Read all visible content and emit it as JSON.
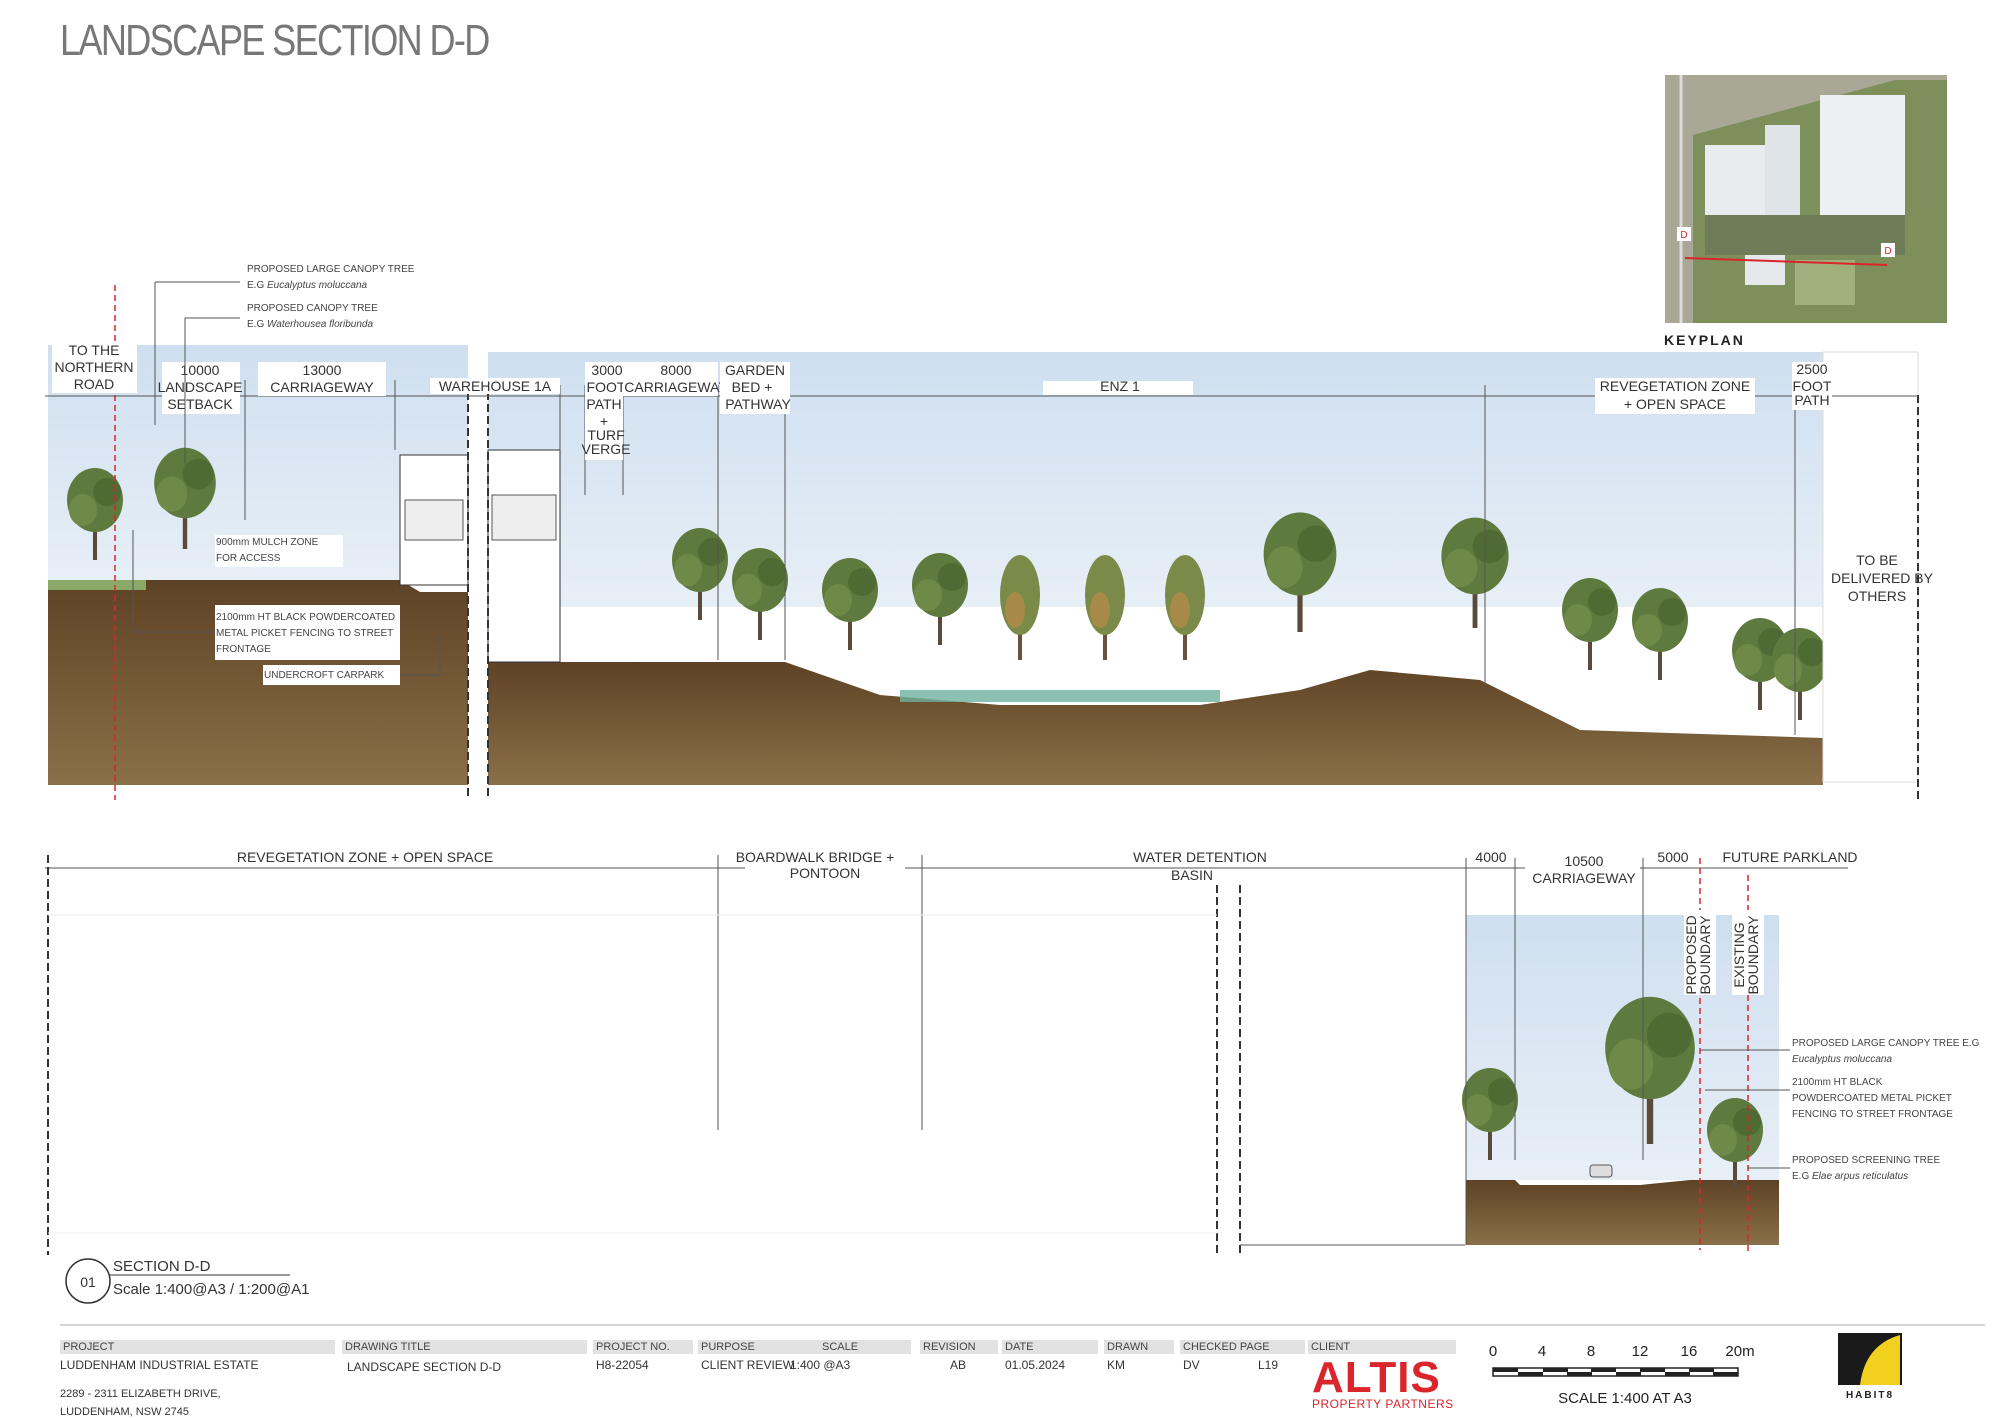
{
  "title": "LANDSCAPE SECTION D-D",
  "keyplan": {
    "label": "KEYPLAN",
    "marker": "D"
  },
  "top_section": {
    "dims": {
      "northern_road": "TO THE NORTHERN ROAD",
      "setback_num": "10000",
      "setback_label": "LANDSCAPE SETBACK",
      "carriageway_num": "13000",
      "carriageway_label": "CARRIAGEWAY",
      "warehouse": "WAREHOUSE 1A",
      "footpath_num": "3000",
      "footpath_label": "FOOTPATH + TURF VERGE",
      "carriageway2_num": "8000",
      "carriageway2_label": "CARRIAGEWAY",
      "garden": "GARDEN BED + PATHWAY",
      "enz": "ENZ 1",
      "reveg": "REVEGETATION ZONE + OPEN SPACE",
      "footpath2_num": "2500",
      "footpath2_label": "FOOT PATH",
      "delivered": "TO BE DELIVERED BY OTHERS"
    },
    "notes": {
      "large_tree_1": "PROPOSED LARGE CANOPY TREE",
      "large_tree_2": "E.G",
      "large_tree_species": "Eucalyptus moluccana",
      "canopy_tree_1": "PROPOSED CANOPY TREE",
      "canopy_tree_2": "E.G",
      "canopy_tree_species": "Waterhousea floribunda",
      "mulch_1": "900mm MULCH ZONE",
      "mulch_2": "FOR ACCESS",
      "fence_1": "2100mm HT BLACK POWDERCOATED",
      "fence_2": "METAL PICKET FENCING TO STREET",
      "fence_3": "FRONTAGE",
      "carpark": "UNDERCROFT CARPARK"
    }
  },
  "bottom_section": {
    "dims": {
      "reveg": "REVEGETATION ZONE + OPEN SPACE",
      "boardwalk_1": "BOARDWALK BRIDGE +",
      "boardwalk_2": "PONTOON",
      "basin_1": "WATER DETENTION",
      "basin_2": "BASIN",
      "d4000": "4000",
      "d10500": "10500",
      "carriageway": "CARRIAGEWAY",
      "d5000": "5000",
      "parkland": "FUTURE PARKLAND",
      "boundary": "BOUNDARY",
      "proposed": "PROPOSED",
      "existing": "EXISTING"
    },
    "delivered_1": "TO BE DELIVERED",
    "delivered_2": "BY OTHERS",
    "notes": {
      "tree_1": "PROPOSED LARGE CANOPY TREE E.G",
      "tree_species": "Eucalyptus moluccana",
      "fence_1": "2100mm HT BLACK",
      "fence_2": "POWDERCOATED METAL PICKET",
      "fence_3": "FENCING TO STREET FRONTAGE",
      "screen_1": "PROPOSED SCREENING TREE",
      "screen_2": "E.G",
      "screen_species": "Elae arpus reticulatus"
    }
  },
  "section_tag": {
    "number": "01",
    "name": "SECTION D-D",
    "scale": "Scale 1:400@A3 / 1:200@A1"
  },
  "title_block": {
    "project_h": "PROJECT",
    "project_v": "LUDDENHAM INDUSTRIAL ESTATE",
    "address_1": "2289 - 2311 ELIZABETH DRIVE,",
    "address_2": "LUDDENHAM, NSW 2745",
    "drawing_h": "DRAWING TITLE",
    "drawing_v": "LANDSCAPE SECTION D-D",
    "projno_h": "PROJECT NO.",
    "projno_v": "H8-22054",
    "purpose_h": "PURPOSE",
    "purpose_v": "CLIENT REVIEW",
    "scale_h": "SCALE",
    "scale_v": "1:400 @A3",
    "revision_h": "REVISION",
    "revision_v": "AB",
    "date_h": "DATE",
    "date_v": "01.05.2024",
    "drawn_h": "DRAWN",
    "drawn_v": "KM",
    "checked_h": "CHECKED",
    "checked_v": "DV",
    "page_h": "PAGE",
    "page_v": "L19",
    "client_h": "CLIENT",
    "client_logo": "ALTIS",
    "client_sub": "PROPERTY PARTNERS",
    "scalebar_ticks": [
      "0",
      "4",
      "8",
      "12",
      "16",
      "20m"
    ],
    "scalebar_label": "SCALE 1:400 AT A3",
    "firm_logo": "HABIT8"
  },
  "colors": {
    "sky": "#dce8f4",
    "soil": "#7a5a38",
    "water": "#6fb0a0",
    "tree": "#5f7a3e",
    "red": "#d9252b",
    "grass": "#8aa866"
  }
}
